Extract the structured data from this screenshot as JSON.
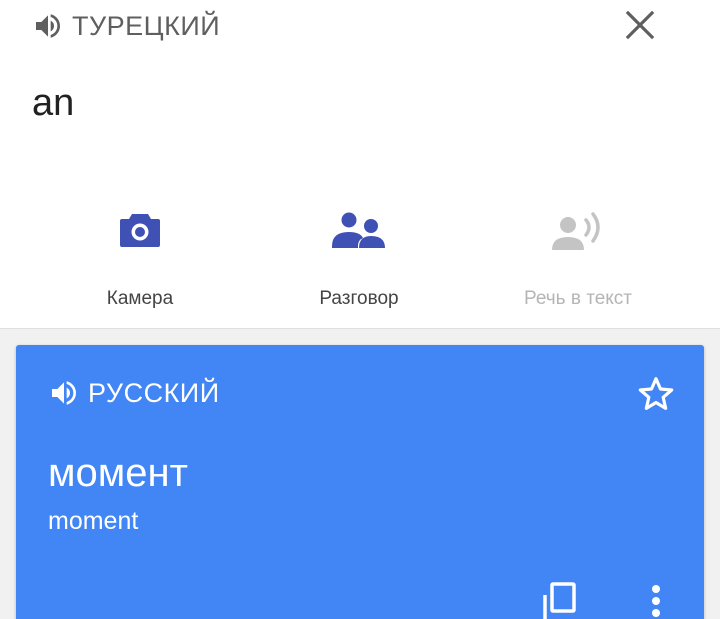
{
  "source": {
    "language": "ТУРЕЦКИЙ",
    "text": "an"
  },
  "tools": [
    {
      "label": "Камера",
      "icon": "camera-icon",
      "enabled": true
    },
    {
      "label": "Разговор",
      "icon": "conversation-icon",
      "enabled": true
    },
    {
      "label": "Речь в текст",
      "icon": "speech-to-text-icon",
      "enabled": false
    }
  ],
  "result": {
    "language": "РУССКИЙ",
    "translation": "момент",
    "transliteration": "moment"
  },
  "colors": {
    "accent": "#3f51b5",
    "card": "#4285f4",
    "disabled": "#c4c4c4",
    "muted_text": "#5f5f5f"
  }
}
